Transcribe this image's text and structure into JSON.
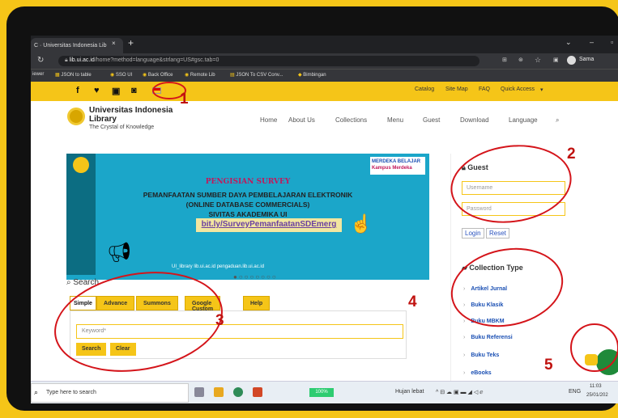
{
  "browser": {
    "tab_title": "C · Universitas Indonesia Lib",
    "tab_close": "×",
    "new_tab": "+",
    "url_domain": "lib.ui.ac.id",
    "url_path": "/home?method=language&strlang=US#gsc.tab=0",
    "user": "Sama",
    "bookmarks": [
      "iewer",
      "JSON to table",
      "SSO UI",
      "Back Office",
      "Remote Lib",
      "JSON To CSV Conv...",
      "Bimbingan"
    ]
  },
  "site": {
    "social": [
      "f",
      "♥",
      "▣",
      "◙"
    ],
    "top_nav": [
      "Catalog",
      "Site Map",
      "FAQ",
      "Quick Access"
    ],
    "title_line1": "Universitas Indonesia",
    "title_line2": "Library",
    "subtitle": "The Crystal of Knowledge",
    "menu": [
      "Home",
      "About Us",
      "Collections",
      "Menu",
      "Guest",
      "Download",
      "Language"
    ],
    "banner": {
      "heading": "PENGISIAN SURVEY",
      "line1": "PEMANFAATAN SUMBER DAYA PEMBELAJARAN ELEKTRONIK",
      "line2": "(ONLINE DATABASE COMMERCIALS)",
      "line3": "SIVITAS AKADEMIKA UI",
      "link": "bit.ly/SurveyPemanfaatanSDEmerg",
      "merdeka": "MERDEKA BELAJAR",
      "kampus": "Kampus Merdeka",
      "handles": "UI_library   lib.ui.ac.id   pengaduan.lib.ui.ac.id",
      "dots": "●○○○○○○○"
    },
    "search": {
      "label": "Search",
      "tabs": [
        "Simple",
        "Advance",
        "Summons",
        "Google Custom",
        "Help"
      ],
      "placeholder": "Keyword*",
      "search_btn": "Search",
      "clear_btn": "Clear"
    },
    "guest": {
      "title": "Guest",
      "username": "Username",
      "password": "Password",
      "login": "Login",
      "reset": "Reset"
    },
    "collection": {
      "title": "Collection Type",
      "items": [
        "Artikel Jurnal",
        "Buku Klasik",
        "Buku MBKM",
        "Buku Referensi",
        "Buku Teks",
        "eBooks"
      ]
    }
  },
  "taskbar": {
    "search": "Type here to search",
    "weather": "Hujan lebat",
    "lang": "ENG",
    "time": "11:03",
    "date": "25/01/202",
    "battery": "100%"
  },
  "annotations": [
    "1",
    "2",
    "3",
    "4",
    "5"
  ],
  "colors": {
    "brand_yellow": "#f5c518",
    "annotation_red": "#d4141a"
  }
}
